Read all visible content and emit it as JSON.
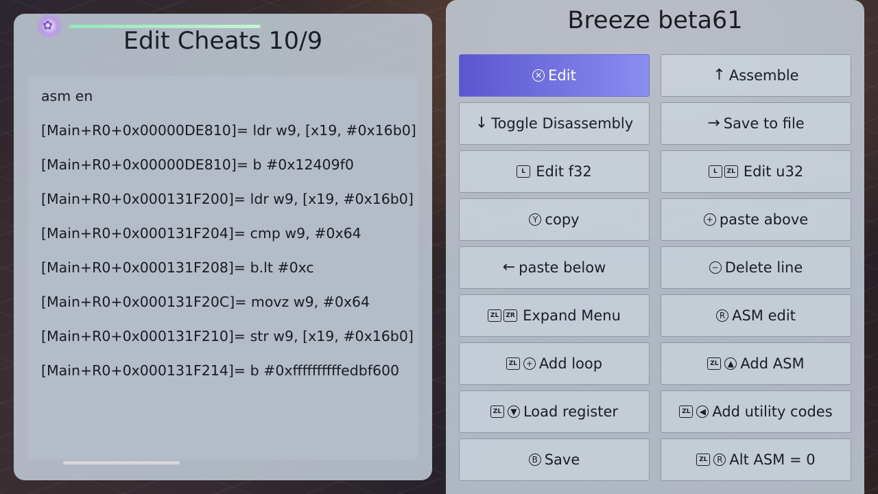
{
  "left": {
    "title": "Edit Cheats 10/9",
    "lines": [
      "asm en",
      "[Main+R0+0x00000DE810]= ldr w9, [x19, #0x16b0]",
      "[Main+R0+0x00000DE810]= b #0x12409f0",
      "[Main+R0+0x000131F200]= ldr w9, [x19, #0x16b0]",
      "[Main+R0+0x000131F204]= cmp w9, #0x64",
      "[Main+R0+0x000131F208]= b.lt #0xc",
      "[Main+R0+0x000131F20C]= movz w9, #0x64",
      "[Main+R0+0x000131F210]= str w9, [x19, #0x16b0]",
      "[Main+R0+0x000131F214]= b #0xffffffffffedbf600"
    ]
  },
  "right": {
    "title": "Breeze beta61",
    "buttons": [
      {
        "label": "Edit",
        "icons": [
          {
            "type": "circle",
            "glyph": "✕",
            "name": "a-button-icon"
          }
        ],
        "selected": true
      },
      {
        "label": "Assemble",
        "icons": [
          {
            "type": "arrow",
            "glyph": "↑",
            "name": "dpad-up-icon"
          }
        ]
      },
      {
        "label": "Toggle Disassembly",
        "icons": [
          {
            "type": "arrow",
            "glyph": "↓",
            "name": "dpad-down-icon"
          }
        ]
      },
      {
        "label": "Save to file",
        "icons": [
          {
            "type": "arrow",
            "glyph": "→",
            "name": "dpad-right-icon"
          }
        ]
      },
      {
        "label": "Edit f32",
        "icons": [
          {
            "type": "box",
            "glyph": "L",
            "name": "l-button-icon"
          }
        ]
      },
      {
        "label": "Edit u32",
        "icons": [
          {
            "type": "box",
            "glyph": "L",
            "name": "l-button-icon"
          },
          {
            "type": "box",
            "glyph": "ZL",
            "name": "zl-button-icon"
          }
        ]
      },
      {
        "label": "copy",
        "icons": [
          {
            "type": "circle",
            "glyph": "Y",
            "name": "y-button-icon"
          }
        ]
      },
      {
        "label": "paste above",
        "icons": [
          {
            "type": "circle",
            "glyph": "+",
            "name": "plus-button-icon"
          }
        ]
      },
      {
        "label": "paste below",
        "icons": [
          {
            "type": "arrow",
            "glyph": "←",
            "name": "dpad-left-icon"
          }
        ]
      },
      {
        "label": "Delete line",
        "icons": [
          {
            "type": "circle",
            "glyph": "−",
            "name": "minus-button-icon"
          }
        ]
      },
      {
        "label": "Expand Menu",
        "icons": [
          {
            "type": "box",
            "glyph": "ZL",
            "name": "zl-button-icon"
          },
          {
            "type": "box",
            "glyph": "ZR",
            "name": "zr-button-icon"
          }
        ]
      },
      {
        "label": "ASM edit",
        "icons": [
          {
            "type": "circle",
            "glyph": "R",
            "name": "right-stick-icon"
          }
        ]
      },
      {
        "label": "Add loop",
        "icons": [
          {
            "type": "box",
            "glyph": "ZL",
            "name": "zl-button-icon"
          },
          {
            "type": "circle",
            "glyph": "+",
            "name": "plus-button-icon"
          }
        ]
      },
      {
        "label": "Add ASM",
        "icons": [
          {
            "type": "box",
            "glyph": "ZL",
            "name": "zl-button-icon"
          },
          {
            "type": "circle",
            "glyph": "▲",
            "name": "dpad-up-filled-icon"
          }
        ]
      },
      {
        "label": "Load register",
        "icons": [
          {
            "type": "box",
            "glyph": "ZL",
            "name": "zl-button-icon"
          },
          {
            "type": "circle",
            "glyph": "▼",
            "name": "dpad-down-filled-icon"
          }
        ]
      },
      {
        "label": "Add utility codes",
        "icons": [
          {
            "type": "box",
            "glyph": "ZL",
            "name": "zl-button-icon"
          },
          {
            "type": "circle",
            "glyph": "◀",
            "name": "dpad-left-filled-icon"
          }
        ]
      },
      {
        "label": "Save",
        "icons": [
          {
            "type": "circle",
            "glyph": "B",
            "name": "b-button-icon"
          }
        ]
      },
      {
        "label": "Alt ASM = 0",
        "icons": [
          {
            "type": "box",
            "glyph": "ZL",
            "name": "zl-button-icon"
          },
          {
            "type": "circle",
            "glyph": "R",
            "name": "right-stick-icon"
          }
        ]
      }
    ]
  },
  "colors": {
    "selected_start": "#5a56cf",
    "selected_end": "#8a8ef0",
    "panel": "#c4ceda",
    "text": "#1c1c24"
  }
}
